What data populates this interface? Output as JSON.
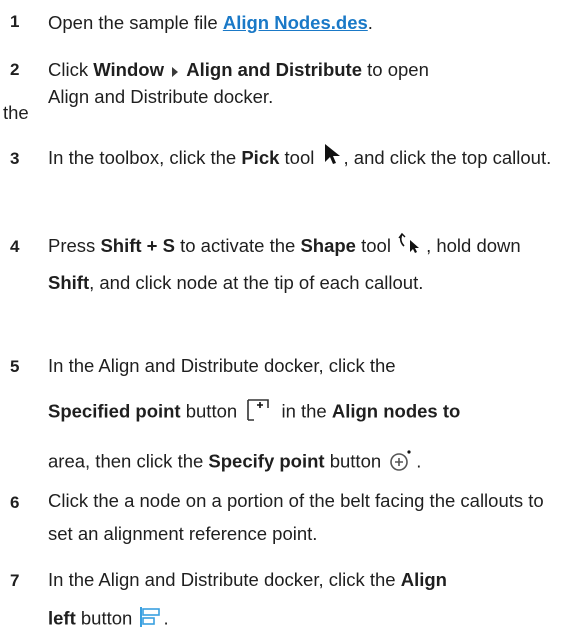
{
  "steps": [
    {
      "num": "1",
      "pre": "Open the sample file ",
      "link": "Align Nodes.des",
      "post": "."
    },
    {
      "num": "2",
      "pre": "Click ",
      "menu1": "Window",
      "menu2": "Align and Distribute",
      "post": " to open",
      "line2_the": "the",
      "line2_rest": "Align and Distribute docker."
    },
    {
      "num": "3",
      "pre": "In the toolbox, click the ",
      "bold1": "Pick",
      "mid": " tool ",
      "post": ", and click the top callout."
    },
    {
      "num": "4",
      "pre": "Press ",
      "bold1": "Shift + S",
      "mid1": " to activate the ",
      "bold2": "Shape",
      "mid2": " tool ",
      "mid3": ", hold down ",
      "bold3": "Shift",
      "post": ", and click node at the tip of each callout."
    },
    {
      "num": "5",
      "line1": "In the Align and Distribute docker, click the",
      "bold1": "Specified point",
      "mid1": " button ",
      "mid2": " in the ",
      "bold2": "Align nodes to",
      "line3_pre": "area, then click the ",
      "bold3": "Specify point",
      "line3_mid": " button ",
      "line3_post": "."
    },
    {
      "num": "6",
      "text": "Click the a node on a portion of the belt facing the callouts to set an alignment reference point."
    },
    {
      "num": "7",
      "line1_pre": "In the Align and Distribute docker, click the ",
      "bold1": "Align",
      "bold2": "left",
      "mid": " button ",
      "post": "."
    }
  ],
  "icons": {
    "menu_separator": "triangle-right-icon",
    "pick_tool": "pick-tool-arrow-icon",
    "shape_tool": "shape-tool-icon",
    "specified_point": "specified-point-button-icon",
    "specify_point": "specify-point-crosshair-icon",
    "align_left": "align-left-icon"
  },
  "colors": {
    "link": "#1a79c7",
    "text": "#1f1f1f",
    "align_icon": "#3aa0e0"
  }
}
